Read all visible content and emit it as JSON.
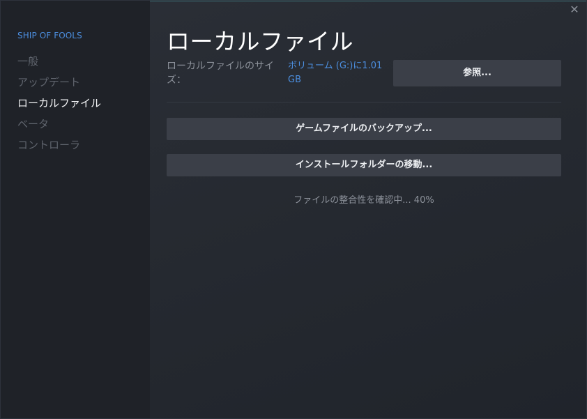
{
  "window": {
    "close_glyph": "✕"
  },
  "sidebar": {
    "game_title": "SHIP OF FOOLS",
    "items": [
      {
        "label": "一般"
      },
      {
        "label": "アップデート"
      },
      {
        "label": "ローカルファイル",
        "active": true
      },
      {
        "label": "ベータ"
      },
      {
        "label": "コントローラ"
      }
    ]
  },
  "main": {
    "title": "ローカルファイル",
    "size_label": "ローカルファイルのサイズ：",
    "size_value": "ボリューム (G:)に1.01 GB",
    "browse_label": "参照...",
    "backup_label": "ゲームファイルのバックアップ...",
    "move_label": "インストールフォルダーの移動...",
    "verify_status": "ファイルの整合性を確認中... 40%",
    "verify_progress_percent": 40
  },
  "colors": {
    "accent": "#4c8fe0",
    "active_text": "#f2f3f5",
    "inactive_text": "#5f646d",
    "button_bg": "#3b3f48"
  },
  "icons": {
    "close": "close-icon"
  }
}
